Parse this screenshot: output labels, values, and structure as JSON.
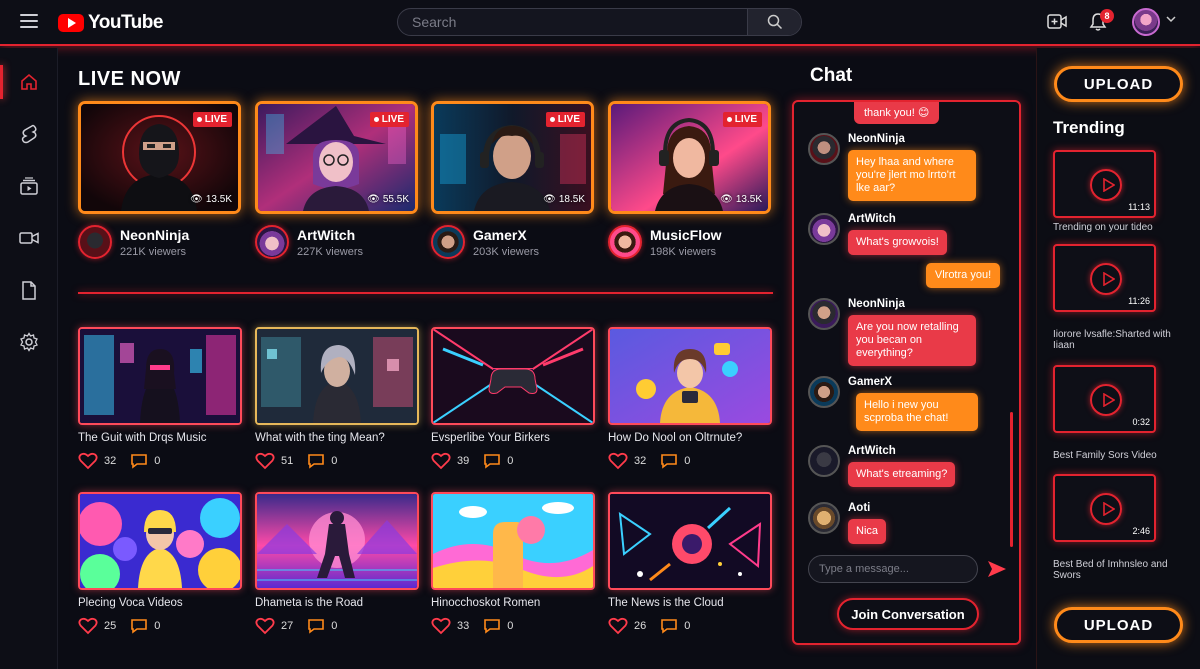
{
  "brand": {
    "name": "YouTube",
    "accent": "#e3232f",
    "glow_orange": "#ff8a1a"
  },
  "search": {
    "placeholder": "Search"
  },
  "notifications": {
    "count": "8"
  },
  "main": {
    "section_title": "LIVE NOW",
    "live_streams": [
      {
        "badge": "LIVE",
        "views": "13.5K",
        "name": "NeonNinja",
        "viewers": "221K viewers"
      },
      {
        "badge": "LIVE",
        "views": "55.5K",
        "name": "ArtWitch",
        "viewers": "227K viewers"
      },
      {
        "badge": "LIVE",
        "views": "18.5K",
        "name": "GamerX",
        "viewers": "203K viewers"
      },
      {
        "badge": "LIVE",
        "views": "13.5K",
        "name": "MusicFlow",
        "viewers": "198K viewers"
      }
    ],
    "videos": [
      {
        "title": "The Guit with Drqs Music",
        "likes": "32",
        "comments": "0"
      },
      {
        "title": "What with the ting Mean?",
        "likes": "51",
        "comments": "0"
      },
      {
        "title": "Evsperlibe Your Birkers",
        "likes": "39",
        "comments": "0"
      },
      {
        "title": "How Do Nool on Oltrnute?",
        "likes": "32",
        "comments": "0"
      },
      {
        "title": "Plecing Voca Videos",
        "likes": "25",
        "comments": "0"
      },
      {
        "title": "Dhameta is the Road",
        "likes": "27",
        "comments": "0"
      },
      {
        "title": "Hinocchoskot Romen",
        "likes": "33",
        "comments": "0"
      },
      {
        "title": "The News is the Cloud",
        "likes": "26",
        "comments": "0"
      }
    ]
  },
  "chat": {
    "title": "Chat",
    "top_message": "thank you! 😊",
    "messages": [
      {
        "user": "NeonNinja",
        "text": "Hey lhaa and where you're jlert mo lrrto'rt lke aar?"
      },
      {
        "user": "ArtWitch",
        "text": "What's growvois!"
      },
      {
        "user": "",
        "text": "Vlrotra you!"
      },
      {
        "user": "NeonNinja",
        "text": "Are you now retalling you becan on everything?"
      },
      {
        "user": "GamerX",
        "text": "Hello i new you scproba the chat!"
      },
      {
        "user": "ArtWitch",
        "text": "What's etreaming?"
      },
      {
        "user": "Aoti",
        "text": "Nica"
      }
    ],
    "input_placeholder": "Type a message...",
    "join_label": "Join Conversation"
  },
  "right": {
    "upload_label": "UPLOAD",
    "trending_title": "Trending",
    "items": [
      {
        "duration": "11:13",
        "label": "Trending on your tideo"
      },
      {
        "duration": "11:26",
        "label": "Iiorore lvsafle:Sharted with Iiaan"
      },
      {
        "duration": "0:32",
        "label": "Best Family Sors Video"
      },
      {
        "duration": "2:46",
        "label": "Best Bed of Imhnsleo and Swors"
      }
    ]
  }
}
